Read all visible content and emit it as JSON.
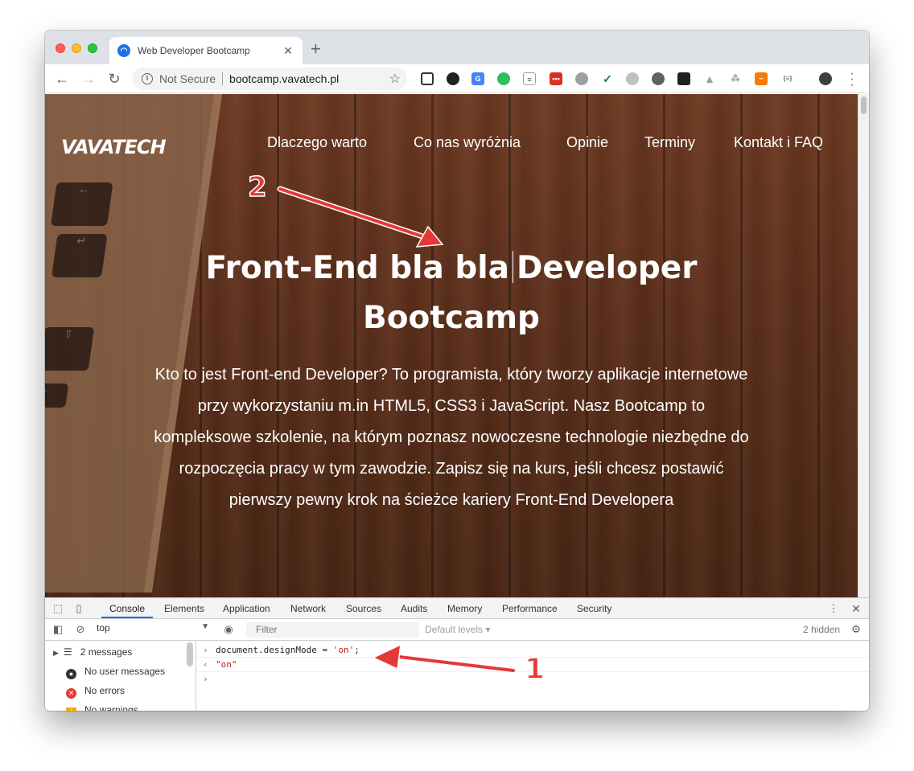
{
  "browser": {
    "tab_title": "Web Developer Bootcamp",
    "tab_close": "✕",
    "new_tab": "+",
    "security_label": "Not Secure",
    "url": "bootcamp.vavatech.pl"
  },
  "site": {
    "logo": "VAVATECH",
    "nav": [
      "Dlaczego warto",
      "Co nas wyróżnia",
      "Opinie",
      "Terminy",
      "Kontakt i FAQ"
    ],
    "hero_title_part1": "Front-End bla bla",
    "hero_title_part2": "Developer Bootcamp",
    "hero_text": "Kto to jest Front-end Developer? To programista, który tworzy aplikacje internetowe przy wykorzystaniu m.in HTML5, CSS3 i JavaScript. Nasz Bootcamp to kompleksowe szkolenie, na którym poznasz nowoczesne technologie niezbędne do rozpoczęcia pracy w tym zawodzie. Zapisz się na kurs, jeśli chcesz postawić pierwszy pewny krok na ścieżce kariery Front-End Developera"
  },
  "devtools": {
    "tabs": [
      "Console",
      "Elements",
      "Application",
      "Network",
      "Sources",
      "Audits",
      "Memory",
      "Performance",
      "Security"
    ],
    "context": "top",
    "filter_placeholder": "Filter",
    "levels": "Default levels ▾",
    "hidden_count": "2 hidden",
    "sidebar": [
      "2 messages",
      "No user messages",
      "No errors",
      "No warnings"
    ],
    "command_code": "document.designMode = ",
    "command_string": "'on'",
    "command_end": ";",
    "result": "\"on\""
  },
  "annotations": {
    "label1": "1",
    "label2": "2",
    "color": "#e53935"
  }
}
